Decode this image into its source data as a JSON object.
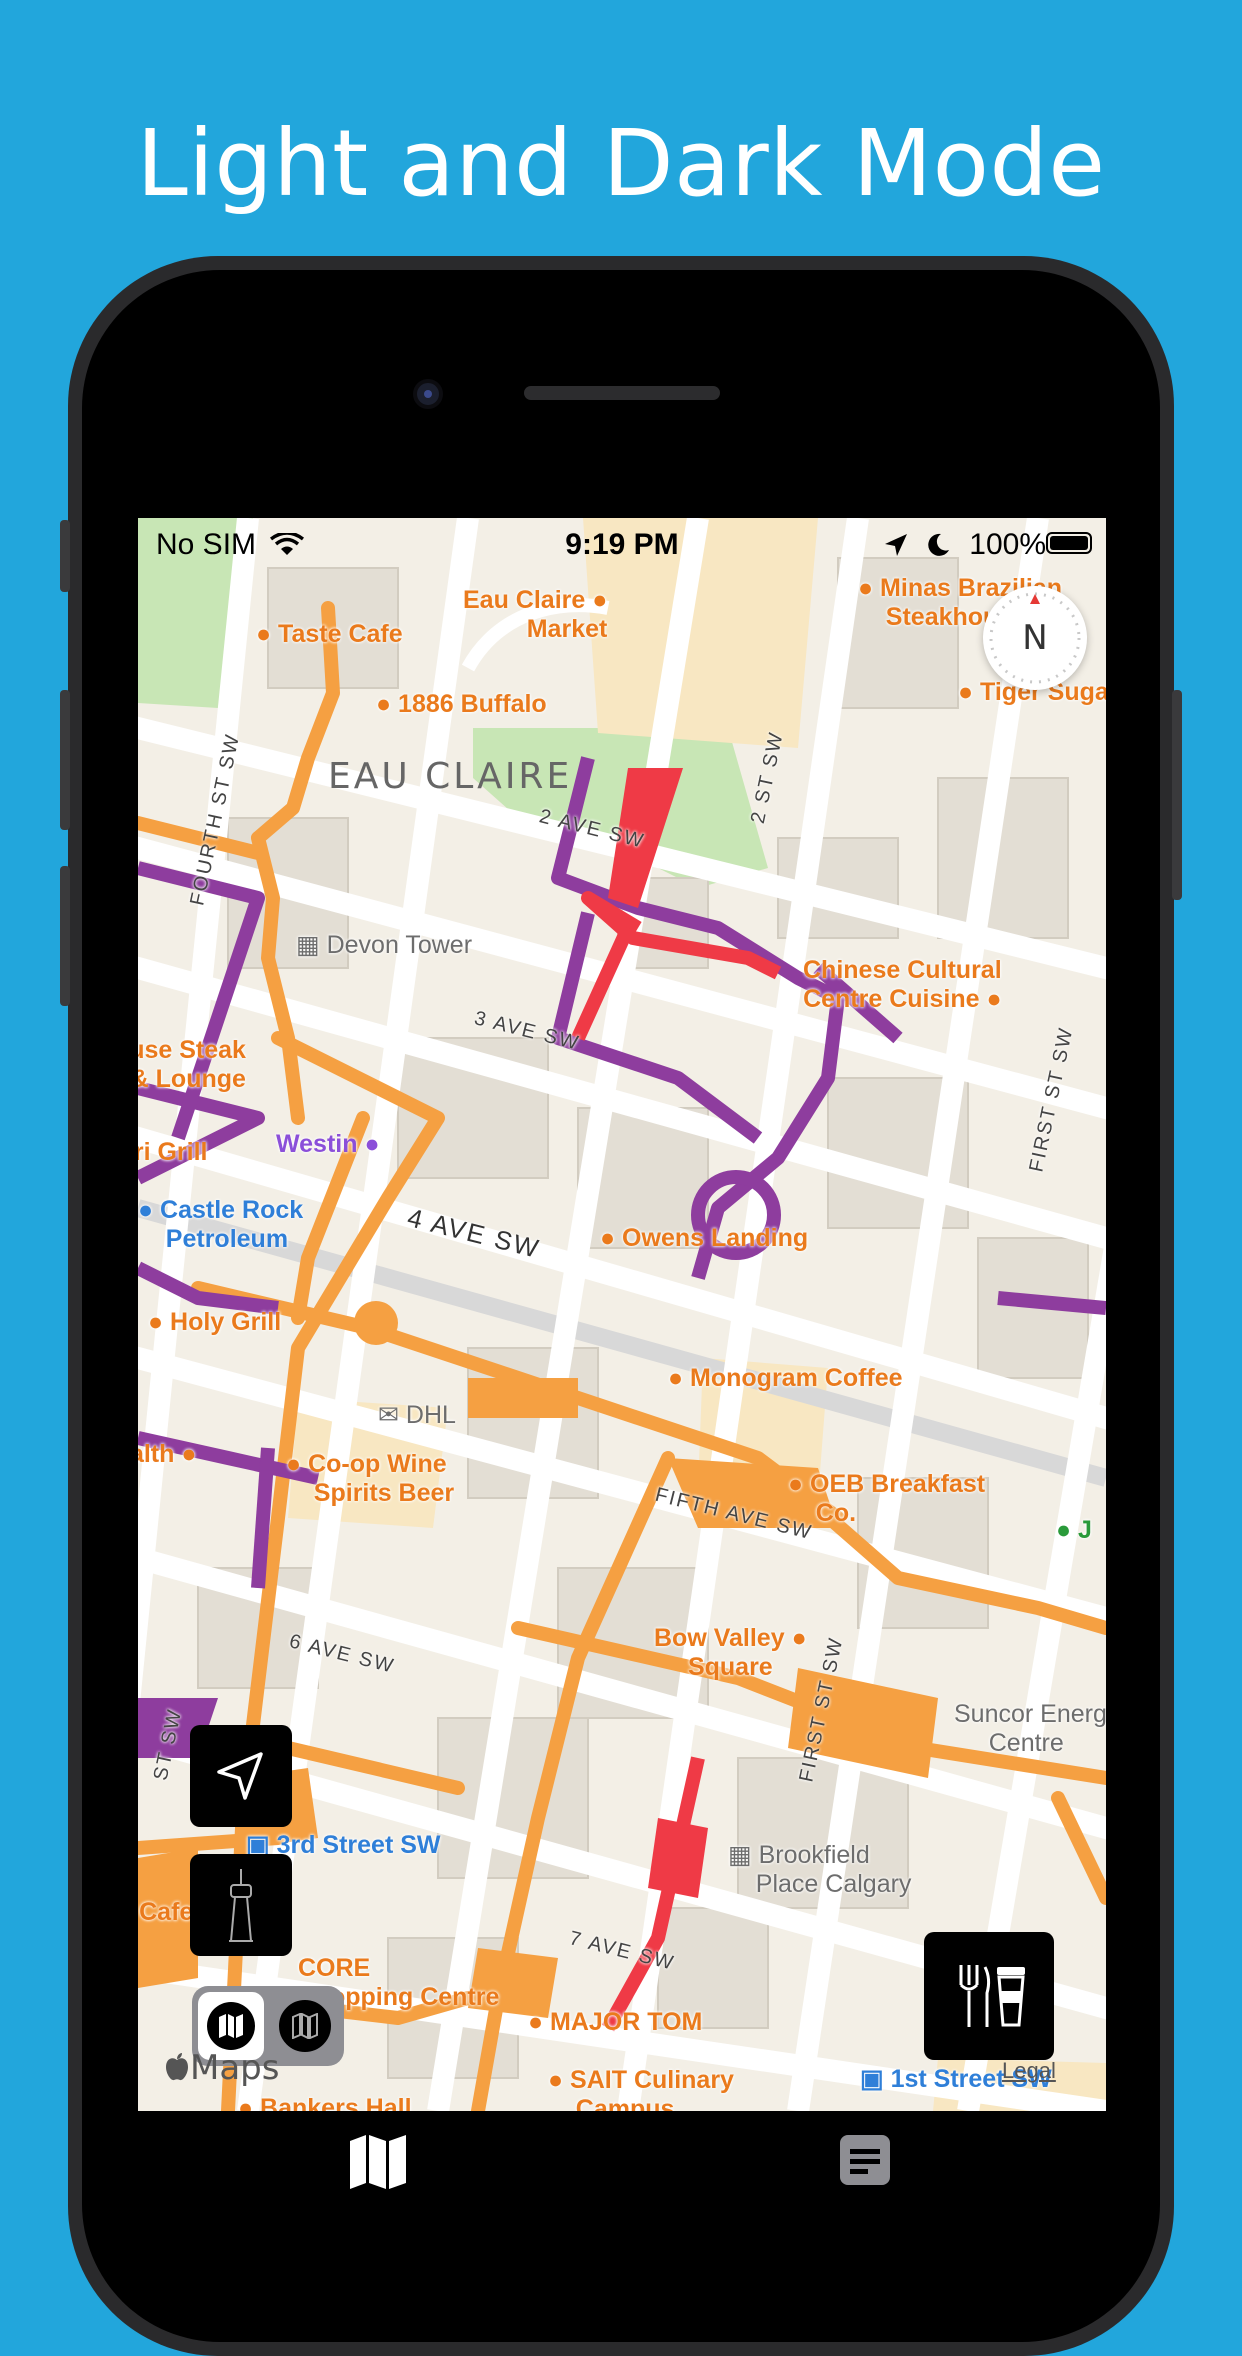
{
  "headline": "Light and Dark Mode",
  "status_bar": {
    "carrier": "No SIM",
    "time": "9:19 PM",
    "battery": "100%"
  },
  "compass_label": "N",
  "district": "EAU CLAIRE",
  "streets": {
    "second_ave": "2 AVE SW",
    "third_ave": "3 AVE SW",
    "fourth_ave": "4 AVE SW",
    "fifth_ave": "FIFTH AVE SW",
    "sixth_ave": "6 AVE SW",
    "seventh_ave": "7 AVE SW",
    "fourth_st": "FOURTH ST SW",
    "second_st": "2 ST SW",
    "first_st_e": "FIRST ST SW",
    "first_st": "FIRST ST SW",
    "st_sw": "ST SW"
  },
  "pois": {
    "taste_cafe": "Taste Cafe",
    "eau_claire_market_1": "Eau Claire",
    "eau_claire_market_2": "Market",
    "minas_1": "Minas Brazilian",
    "minas_2": "Steakhouse",
    "buffalo": "1886 Buffalo",
    "tiger": "Tiger Sugar",
    "devon": "Devon Tower",
    "chinese_1": "Chinese Cultural",
    "chinese_2": "Centre Cuisine",
    "steak_1": "Vintage Chophouse Steak",
    "steak_2": "Bar & Lounge",
    "grill": "Anejo Gri Grill",
    "westin": "Westin",
    "castle_1": "Castle Rock",
    "castle_2": "Petroleum",
    "owens": "Owens Landing",
    "holy": "Holy Grill",
    "monogram": "Monogram Coffee",
    "dhl": "DHL",
    "health": "Health",
    "coop_1": "Co-op Wine",
    "coop_2": "Spirits Beer",
    "oeb_1": "OEB Breakfast",
    "oeb_2": "Co.",
    "j": "J",
    "bowvalley_1": "Bow Valley",
    "bowvalley_2": "Square",
    "suncor_1": "Suncor Energy",
    "suncor_2": "Centre",
    "third_street": "3rd Street SW",
    "brookfield_1": "Brookfield",
    "brookfield_2": "Place Calgary",
    "cafe": "Cafe Cafe",
    "core_1": "CORE",
    "core_2": "Shopping Centre",
    "major_tom": "MAJOR TOM",
    "sait_1": "SAIT Culinary",
    "sait_2": "Campus",
    "first_street": "1st Street SW",
    "bankers": "Bankers Hall"
  },
  "map_attribution": "Maps",
  "legal": "Legal",
  "colors": {
    "background": "#22a6dc",
    "plus15_orange": "#f5a042",
    "plus15_purple": "#8e3d9e",
    "plus15_red": "#ef3a46",
    "park": "#c8e6b5",
    "highlight": "#f8e7c2"
  },
  "icons": {
    "locate": "location-arrow-icon",
    "tower": "calgary-tower-icon",
    "map_mode_light": "map-icon",
    "map_mode_dark": "map-icon",
    "food": "food-drink-icon",
    "tab_map": "map-icon",
    "tab_list": "list-icon"
  }
}
